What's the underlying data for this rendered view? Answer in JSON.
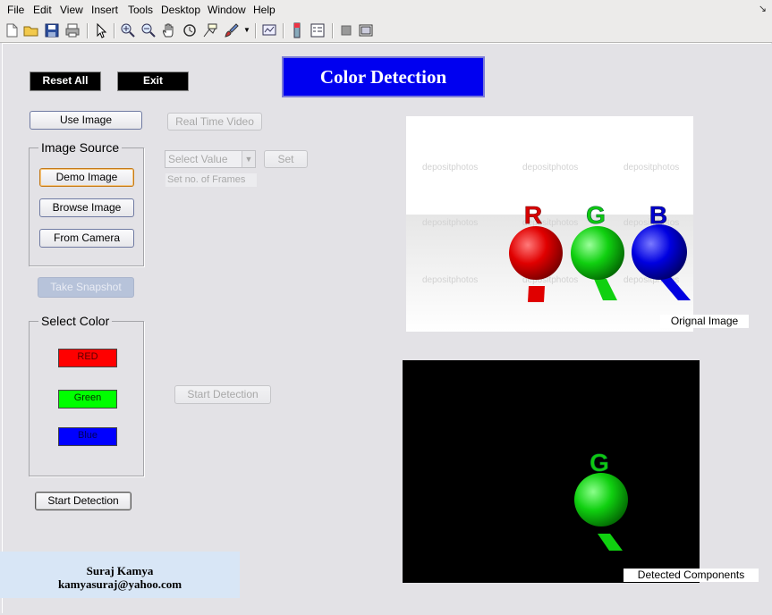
{
  "menu": [
    "File",
    "Edit",
    "View",
    "Insert",
    "Tools",
    "Desktop",
    "Window",
    "Help"
  ],
  "toolbar_icons": [
    "new-file-icon",
    "open-folder-icon",
    "save-icon",
    "print-icon",
    "pointer-icon",
    "zoom-in-icon",
    "zoom-out-icon",
    "pan-hand-icon",
    "rotate-3d-icon",
    "data-cursor-icon",
    "brush-icon",
    "link-plot-icon",
    "colorbar-icon",
    "legend-icon",
    "hide-plot-tools-icon",
    "show-plot-tools-icon"
  ],
  "controls": {
    "reset_all": "Reset All",
    "exit": "Exit",
    "title": "Color Detection",
    "use_image": "Use Image",
    "real_time_video": "Real Time Video",
    "select_value": "Select Value",
    "set": "Set",
    "set_frames": "Set no. of Frames",
    "start_detection_video": "Start Detection",
    "start_detection": "Start Detection"
  },
  "image_source": {
    "title": "Image Source",
    "demo_image": "Demo Image",
    "browse_image": "Browse Image",
    "from_camera": "From Camera"
  },
  "take_snapshot": "Take Snapshot",
  "select_color": {
    "title": "Select Color",
    "red": "RED",
    "green": "Green",
    "blue": "Blue",
    "red_color": "#ff0000",
    "green_color": "#00ff00",
    "blue_color": "#0000ff"
  },
  "original_image": {
    "caption": "Orignal Image",
    "letters": [
      "R",
      "G",
      "B"
    ],
    "watermark": "depositphotos"
  },
  "detected_image": {
    "caption": "Detected Components",
    "letter": "G"
  },
  "author": {
    "name": "Suraj Kamya",
    "email": "kamyasuraj@yahoo.com"
  }
}
